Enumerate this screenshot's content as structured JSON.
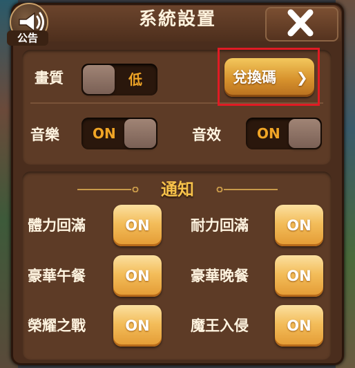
{
  "dialog": {
    "title": "系統設置",
    "announce_label": "公告"
  },
  "settings": {
    "quality_label": "畫質",
    "quality_value": "低",
    "redeem_label": "兌換碼",
    "redeem_chevron": "❯",
    "music_label": "音樂",
    "music_value": "ON",
    "sfx_label": "音效",
    "sfx_value": "ON"
  },
  "notifications": {
    "title": "通知",
    "items": [
      {
        "label": "體力回滿",
        "value": "ON"
      },
      {
        "label": "耐力回滿",
        "value": "ON"
      },
      {
        "label": "豪華午餐",
        "value": "ON"
      },
      {
        "label": "豪華晚餐",
        "value": "ON"
      },
      {
        "label": "榮耀之戰",
        "value": "ON"
      },
      {
        "label": "魔王入侵",
        "value": "ON"
      }
    ]
  },
  "colors": {
    "panel": "#4a2d1d",
    "section": "#5d3b26",
    "accent_orange": "#f3bd5a",
    "highlight_red": "#e01b24"
  }
}
